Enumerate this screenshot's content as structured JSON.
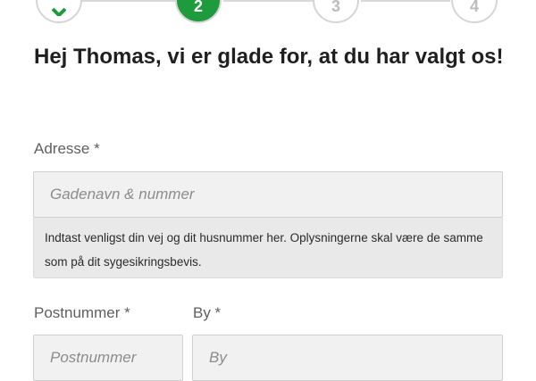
{
  "stepper": {
    "steps": [
      {
        "label": "",
        "state": "done"
      },
      {
        "label": "2",
        "state": "active"
      },
      {
        "label": "3",
        "state": "todo"
      },
      {
        "label": "4",
        "state": "todo"
      }
    ],
    "active_color": "#1e9b3c"
  },
  "heading": "Hej Thomas, vi er glade for, at du har valgt os!",
  "address": {
    "label": "Adresse *",
    "placeholder": "Gadenavn & nummer",
    "hint": "Indtast venligst din vej og dit husnummer her. Oplysningerne skal være de samme som på dit sygesikringsbevis."
  },
  "postal": {
    "label": "Postnummer *",
    "placeholder": "Postnummer"
  },
  "city": {
    "label": "By *",
    "placeholder": "By"
  }
}
